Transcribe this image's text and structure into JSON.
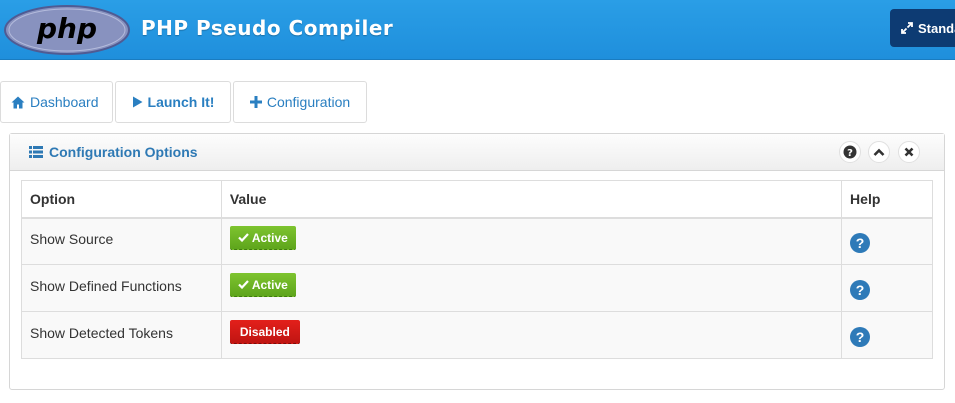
{
  "header": {
    "logo_text": "php",
    "title": "PHP Pseudo Compiler",
    "standalone_label": "Standalone"
  },
  "nav": {
    "dashboard": "Dashboard",
    "launch": "Launch It!",
    "configuration": "Configuration"
  },
  "panel": {
    "title": "Configuration Options",
    "controls": {
      "help": "?",
      "collapse": "^",
      "close": "x"
    }
  },
  "table": {
    "headers": {
      "option": "Option",
      "value": "Value",
      "help": "Help"
    },
    "rows": [
      {
        "option": "Show Source",
        "status": "Active"
      },
      {
        "option": "Show Defined Functions",
        "status": "Active"
      },
      {
        "option": "Show Detected Tokens",
        "status": "Disabled"
      }
    ],
    "help_glyph": "?"
  },
  "colors": {
    "header_blue": "#2197e0",
    "link_blue": "#2a7fc1",
    "active_green": "#6cb325",
    "disabled_red": "#d01a16",
    "help_blue": "#2e7ab8"
  }
}
